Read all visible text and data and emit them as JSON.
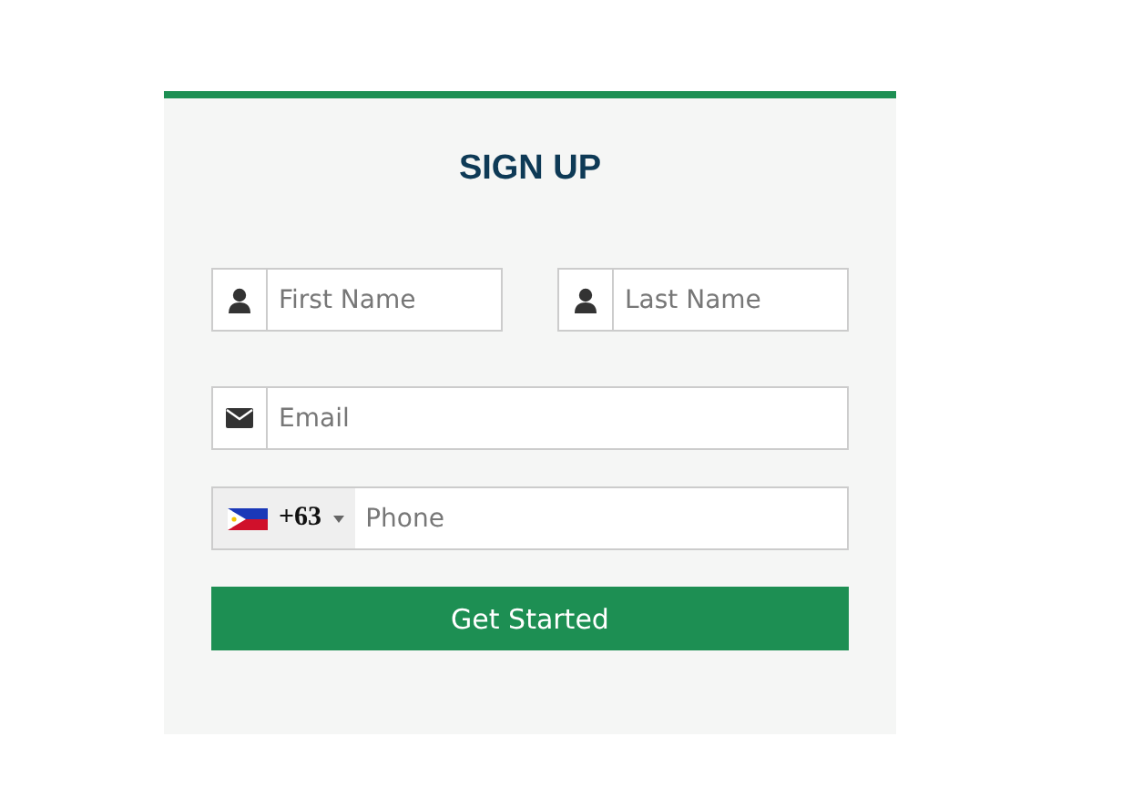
{
  "form": {
    "title": "SIGN UP",
    "name_fields": [
      {
        "placeholder": "First Name"
      },
      {
        "placeholder": "Last Name"
      }
    ],
    "email_field": {
      "placeholder": "Email"
    },
    "phone_field": {
      "country_code": "+63",
      "placeholder": "Phone"
    },
    "submit_button": "Get Started"
  }
}
